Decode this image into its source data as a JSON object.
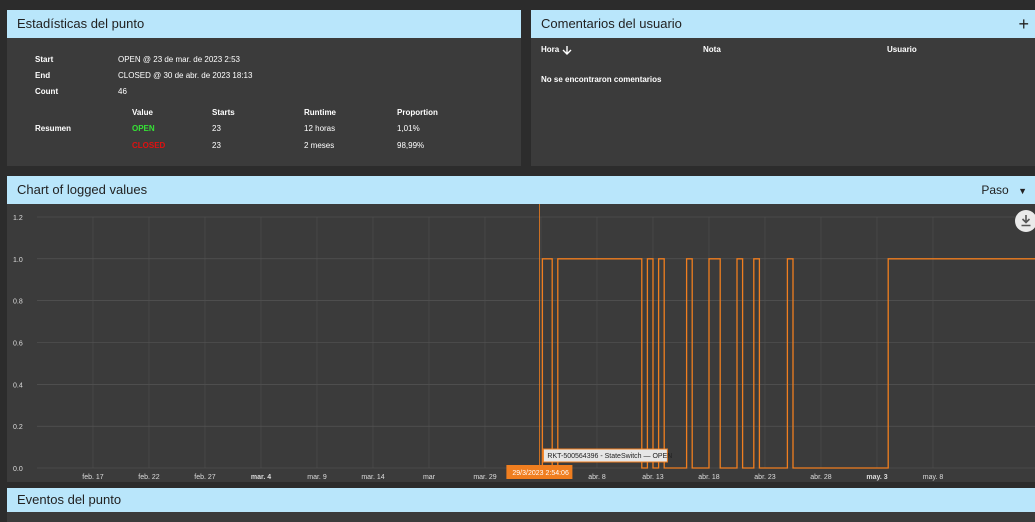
{
  "stats": {
    "title": "Estadísticas del punto",
    "start_label": "Start",
    "start_value": "OPEN @ 23 de mar. de 2023 2:53",
    "end_label": "End",
    "end_value": "CLOSED @ 30 de abr. de 2023 18:13",
    "count_label": "Count",
    "count_value": "46",
    "summary_label": "Resumen",
    "columns": [
      "Value",
      "Starts",
      "Runtime",
      "Proportion"
    ],
    "rows": [
      {
        "value": "OPEN",
        "starts": "23",
        "runtime": "12 horas",
        "proportion": "1,01%",
        "color": "#35e135"
      },
      {
        "value": "CLOSED",
        "starts": "23",
        "runtime": "2 meses",
        "proportion": "98,99%",
        "color": "#e01010"
      }
    ]
  },
  "comments": {
    "title": "Comentarios del usuario",
    "add_symbol": "+",
    "col_hora": "Hora",
    "sort_icon": "arrow-down-icon",
    "col_nota": "Nota",
    "col_usuario": "Usuario",
    "empty": "No se encontraron comentarios"
  },
  "chart": {
    "title": "Chart of logged values",
    "mode": "Paso",
    "mode_caret": "▼",
    "tooltip": "RKT-500564396 - StateSwitch — OPEN",
    "cursor_label": "29/3/2023 2:54:06",
    "download_icon": "download-icon",
    "accent": "#f07e1f"
  },
  "chart_data": {
    "type": "line",
    "step": true,
    "series": [
      {
        "name": "RKT-500564396 - StateSwitch",
        "x": [
          "2023-03-29T03:00",
          "2023-03-30T00:00",
          "2023-03-30T12:00",
          "2023-04-07T00:00",
          "2023-04-07T12:00",
          "2023-04-08T00:00",
          "2023-04-08T12:00",
          "2023-04-09T00:00",
          "2023-04-11T00:00",
          "2023-04-11T12:00",
          "2023-04-13T00:00",
          "2023-04-14T00:00",
          "2023-04-15T12:00",
          "2023-04-16T00:00",
          "2023-04-17T00:00",
          "2023-04-17T12:00",
          "2023-04-20T00:00",
          "2023-04-20T12:00",
          "2023-04-29T00:00",
          "2023-04-29T12:00",
          "2023-05-11T00:00"
        ],
        "y": [
          1,
          0,
          1,
          0,
          1,
          0,
          1,
          0,
          1,
          0,
          1,
          0,
          1,
          0,
          1,
          0,
          1,
          0,
          1,
          1,
          1
        ]
      }
    ],
    "y_ticks": [
      "0.0",
      "0.2",
      "0.4",
      "0.6",
      "0.8",
      "1.0",
      "1.2"
    ],
    "x_ticks": [
      "feb. 17",
      "feb. 22",
      "feb. 27",
      "mar. 4",
      "mar. 9",
      "mar. 14",
      "mar",
      "mar. 29",
      "abr. 3",
      "abr. 8",
      "abr. 13",
      "abr. 18",
      "abr. 23",
      "abr. 28",
      "may. 3",
      "may. 8"
    ],
    "x_ticks_bold": [
      "mar. 4",
      "abr. 3",
      "may. 3"
    ],
    "ylim": [
      0,
      1.2
    ],
    "grid": true
  },
  "events": {
    "title": "Eventos del punto"
  }
}
